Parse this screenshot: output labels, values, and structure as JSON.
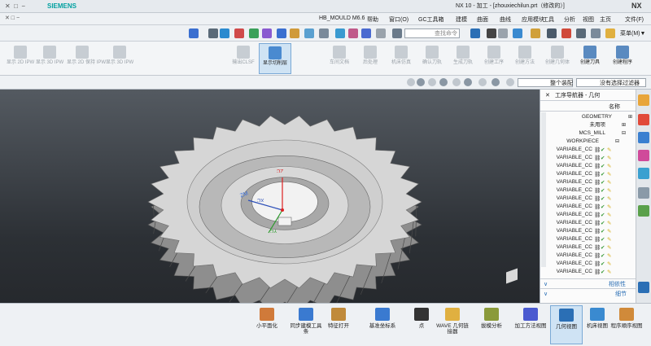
{
  "window": {
    "title": "NX 10 - 加工 - [zhouxiechilun.prt（修改的）]",
    "logo": "NX",
    "brand": "SIEMENS",
    "controls": [
      "−",
      "□",
      "✕"
    ],
    "sub_controls": [
      "−",
      "□",
      "✕"
    ]
  },
  "menubar": {
    "items": [
      "文件(F)",
      "主页",
      "视图",
      "分析",
      "工具",
      "应用模块",
      "曲线",
      "曲面",
      "建模",
      "GC工具箱",
      "窗口(O)",
      "帮助",
      "HB_MOULD M6.6"
    ]
  },
  "toolbar1": {
    "search_placeholder": "查找命令",
    "menu_label": "菜单(M)▼"
  },
  "ribbon": {
    "groups": [
      {
        "label": "创建程序",
        "active": false
      },
      {
        "label": "创建刀具",
        "active": false
      },
      {
        "label": "创建几何体",
        "active": false
      },
      {
        "label": "创建方法",
        "active": false
      },
      {
        "label": "创建工序",
        "active": false
      },
      {
        "label": "生成刀轨",
        "active": false
      },
      {
        "label": "确认刀轨",
        "active": false
      },
      {
        "label": "机床仿真",
        "active": false
      },
      {
        "label": "后处理",
        "active": false
      },
      {
        "label": "车间文档",
        "active": false
      },
      {
        "label": "显示切削层",
        "active": true
      },
      {
        "label": "输出CLSF",
        "active": false
      }
    ],
    "left_items": [
      "显示 2D IPW",
      "显示 3D IPW",
      "显示 2D 保持 IPW",
      "显示 3D IPW"
    ]
  },
  "selbar": {
    "filter_label": "没有选择过滤器",
    "assembly_label": "整个装配"
  },
  "navigator": {
    "title": "工序导航器 - 几何",
    "column": "名称",
    "rows": [
      {
        "label": "GEOMETRY",
        "indent": 0,
        "expanded": false
      },
      {
        "label": "未用项",
        "indent": 1,
        "expanded": false
      },
      {
        "label": "MCS_MILL",
        "indent": 1,
        "expanded": true
      },
      {
        "label": "WORKPIECE",
        "indent": 2,
        "expanded": true
      },
      {
        "label": "VARIABLE_CC",
        "indent": 3
      },
      {
        "label": "VARIABLE_CC",
        "indent": 3
      },
      {
        "label": "VARIABLE_CC",
        "indent": 3
      },
      {
        "label": "VARIABLE_CC",
        "indent": 3
      },
      {
        "label": "VARIABLE_CC",
        "indent": 3
      },
      {
        "label": "VARIABLE_CC",
        "indent": 3
      },
      {
        "label": "VARIABLE_CC",
        "indent": 3
      },
      {
        "label": "VARIABLE_CC",
        "indent": 3
      },
      {
        "label": "VARIABLE_CC",
        "indent": 3
      },
      {
        "label": "VARIABLE_CC",
        "indent": 3
      },
      {
        "label": "VARIABLE_CC",
        "indent": 3
      },
      {
        "label": "VARIABLE_CC",
        "indent": 3
      },
      {
        "label": "VARIABLE_CC",
        "indent": 3
      },
      {
        "label": "VARIABLE_CC",
        "indent": 3
      },
      {
        "label": "VARIABLE_CC",
        "indent": 3
      },
      {
        "label": "VARIABLE_CC",
        "indent": 3
      }
    ],
    "sections": [
      "相依性",
      "细节"
    ]
  },
  "viewport": {
    "axis_labels": {
      "zm": "ZM",
      "xc": "XC",
      "yc": "YC",
      "zc": "ZC"
    }
  },
  "bottombar": {
    "buttons": [
      {
        "label": "程序顺序视图",
        "active": false
      },
      {
        "label": "机床视图",
        "active": false
      },
      {
        "label": "几何视图",
        "active": true
      },
      {
        "label": "加工方法视图",
        "active": false
      },
      {
        "label": "拔模分析",
        "active": false
      },
      {
        "label": "WAVE 几何链接器",
        "active": false
      },
      {
        "label": "点",
        "active": false
      },
      {
        "label": "基准坐标系",
        "active": false
      },
      {
        "label": "特征打开",
        "active": false
      },
      {
        "label": "同步建模工具条",
        "active": false
      },
      {
        "label": "小平面化",
        "active": false
      }
    ]
  },
  "colors": {
    "accent": "#2b6fb5",
    "active_tab": "#cfe3f4",
    "gear": "#c9c9c9"
  }
}
